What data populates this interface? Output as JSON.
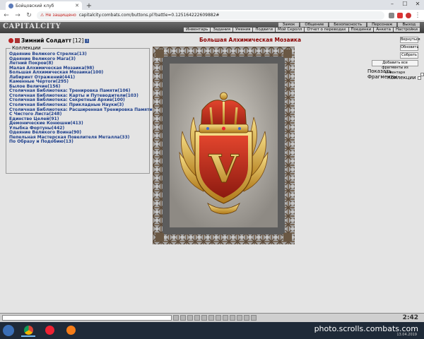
{
  "browser": {
    "tab_title": "Бойцовский клуб",
    "security_warning": "Не защищено",
    "url": "capitalcity.combats.com/buttons.pl?battle=0.125164222609882#"
  },
  "game": {
    "logo": "CAPITALCITY",
    "menu_top": [
      "Замок",
      "Общение",
      "Безопасность",
      "Персонаж",
      "Выход"
    ],
    "menu_bottom": [
      "Инвентарь",
      "Задания",
      "Умения",
      "Подвиги",
      "Мой Скролл",
      "Отчет о переводах",
      "Поединки",
      "Анкета",
      "Настройки"
    ]
  },
  "player": {
    "name": "Зимний Солдатт",
    "level": "[12]",
    "info": "i"
  },
  "collections": {
    "legend": "Коллекции",
    "items": [
      "Одеяние Великого Стрелка(13)",
      "Одеяние Великого Мага(3)",
      "Летний Покров(8)",
      "Малая Алхимическая Мозаика(98)",
      "Большая Алхимическая Мозаика(100)",
      "Лабиринт Отражений(441)",
      "Каменные Чертоги(295)",
      "Былое Величие(156)",
      "Столичная Библиотека: Тренировка Памяти(106)",
      "Столичная Библиотека: Карты и Путеводители(103)",
      "Столичная Библиотека: Секретный Архив(100)",
      "Столичная Библиотека: Прикладные Науки(3)",
      "Столичная Библиотека: Расширенная Тренировка Памяти(100)",
      "С Чистого Листа(248)",
      "Единство Целей(91)",
      "Демонические Конюшни(413)",
      "Улыбка Фортуны(442)",
      "Одеяние Великого Воина(90)",
      "Пепельная Мастерская Повелителя Металла(33)",
      "По Образу и Подобию(13)"
    ]
  },
  "mosaic": {
    "title": "Большая Алхимическая Мозаика",
    "emblem_letter": "V"
  },
  "side_panel": {
    "return_btn": "Вернуться",
    "refresh_btn": "Обновить",
    "collect_btn": "Собрать",
    "add_all_btn": "Добавить все фрагменты из инвентаря",
    "show_fragments": "Показать Фрагменты",
    "collections_label": "Коллекции"
  },
  "chat": {
    "clock": "2:42"
  },
  "taskbar": {
    "watermark": "photo.scrolls.combats.com",
    "date": "13.04.2019"
  },
  "colors": {
    "link": "#1c3e8c",
    "title_red": "#8b0000",
    "frame": "#6d6d6d"
  }
}
